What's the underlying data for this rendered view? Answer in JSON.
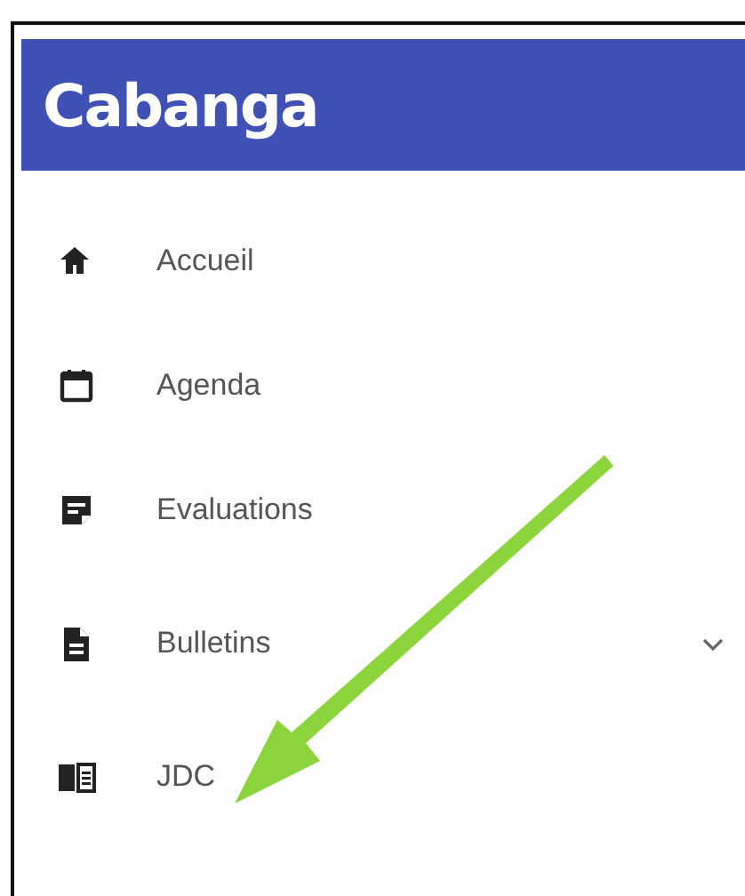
{
  "brand": "Cabanga",
  "nav_items": [
    {
      "label": "Accueil",
      "kind": "link"
    },
    {
      "label": "Agenda",
      "kind": "link"
    },
    {
      "label": "Evaluations",
      "kind": "link"
    },
    {
      "label": "Bulletins",
      "kind": "group",
      "expanded": false
    },
    {
      "label": "JDC",
      "kind": "link"
    }
  ]
}
